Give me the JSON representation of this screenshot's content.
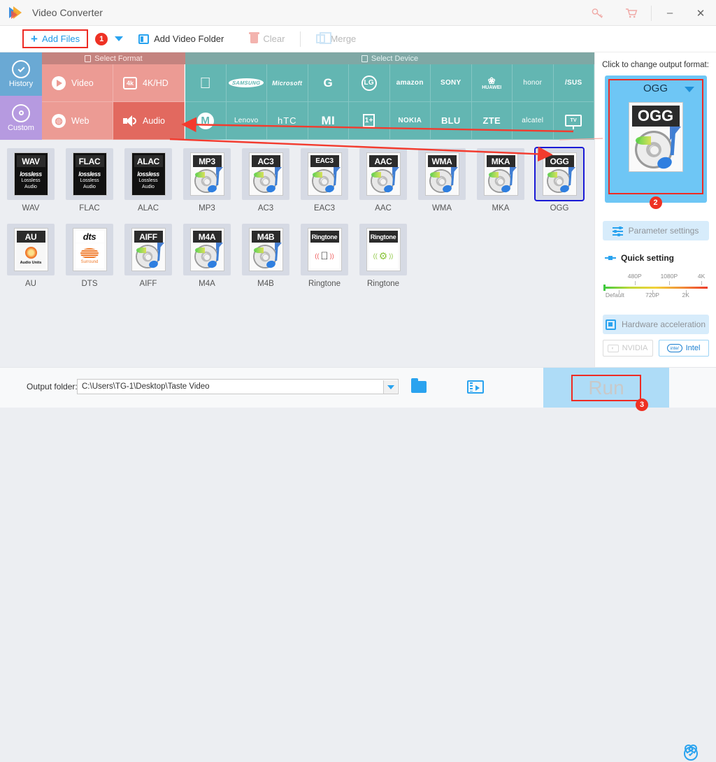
{
  "window": {
    "title": "Video Converter",
    "minimize_label": "–",
    "close_label": "✕",
    "key_icon": "key-icon",
    "cart_icon": "cart-icon"
  },
  "toolbar": {
    "add_files": "Add Files",
    "badge_1": "1",
    "add_video_folder": "Add Video Folder",
    "clear": "Clear",
    "merge": "Merge"
  },
  "sidebar": {
    "items": [
      {
        "label": "History",
        "icon": "history-icon",
        "color": "#6aa9d4"
      },
      {
        "label": "Custom",
        "icon": "gear-icon",
        "color": "#b69ae0"
      }
    ]
  },
  "select_format": {
    "header": "Select Format",
    "items": [
      {
        "label": "Video",
        "icon": "play-icon",
        "selected": false
      },
      {
        "label": "4K/HD",
        "icon": "4k-icon",
        "selected": false
      },
      {
        "label": "Web",
        "icon": "chrome-icon",
        "selected": false
      },
      {
        "label": "Audio",
        "icon": "speaker-icon",
        "selected": true
      }
    ]
  },
  "select_device": {
    "header": "Select Device",
    "row1": [
      "Apple",
      "SAMSUNG",
      "Microsoft",
      "G",
      "LG",
      "amazon",
      "SONY",
      "HUAWEI",
      "honor",
      "/SUS"
    ],
    "row2": [
      "Motorola",
      "Lenovo",
      "hTC",
      "MI",
      "1+",
      "NOKIA",
      "BLU",
      "ZTE",
      "alcatel",
      "TV"
    ]
  },
  "formats": {
    "row1": [
      {
        "label": "WAV",
        "cap": "WAV",
        "style": "lossless",
        "selected": false
      },
      {
        "label": "FLAC",
        "cap": "FLAC",
        "style": "lossless",
        "selected": false
      },
      {
        "label": "ALAC",
        "cap": "ALAC",
        "style": "lossless",
        "selected": false
      },
      {
        "label": "MP3",
        "cap": "MP3",
        "style": "disc",
        "selected": false
      },
      {
        "label": "AC3",
        "cap": "AC3",
        "style": "disc",
        "selected": false
      },
      {
        "label": "EAC3",
        "cap": "EAC3",
        "style": "disc",
        "selected": false
      },
      {
        "label": "AAC",
        "cap": "AAC",
        "style": "disc",
        "selected": false
      },
      {
        "label": "WMA",
        "cap": "WMA",
        "style": "disc",
        "selected": false
      },
      {
        "label": "MKA",
        "cap": "MKA",
        "style": "disc",
        "selected": false
      },
      {
        "label": "OGG",
        "cap": "OGG",
        "style": "disc",
        "selected": true
      }
    ],
    "row2": [
      {
        "label": "AU",
        "cap": "AU",
        "style": "au",
        "selected": false
      },
      {
        "label": "DTS",
        "cap": "dts",
        "style": "dts",
        "selected": false
      },
      {
        "label": "AIFF",
        "cap": "AIFF",
        "style": "disc",
        "selected": false
      },
      {
        "label": "M4A",
        "cap": "M4A",
        "style": "disc",
        "selected": false
      },
      {
        "label": "M4B",
        "cap": "M4B",
        "style": "disc",
        "selected": false
      },
      {
        "label": "Ringtone",
        "cap": "Ringtone",
        "style": "ring-apple",
        "selected": false
      },
      {
        "label": "Ringtone",
        "cap": "Ringtone",
        "style": "ring-android",
        "selected": false
      }
    ],
    "lossless_word": "lossless",
    "lossless_line1": "Lossless",
    "lossless_line2": "Audio",
    "au_sub": "Audio Units",
    "dts_sub": "Surround"
  },
  "right_panel": {
    "title": "Click to change output format:",
    "output_format": "OGG",
    "output_cap": "OGG",
    "badge_2": "2",
    "parameter_settings": "Parameter settings",
    "quick_setting": "Quick setting",
    "quality_top": [
      "480P",
      "1080P",
      "4K"
    ],
    "quality_bottom": [
      "Default",
      "720P",
      "2K"
    ],
    "hardware_acceleration": "Hardware acceleration",
    "nvidia": "NVIDIA",
    "intel": "Intel",
    "intel_badge": "intel"
  },
  "bottom": {
    "output_folder_label": "Output folder:",
    "output_folder_path": "C:\\Users\\TG-1\\Desktop\\Taste Video",
    "open_folder_icon": "open-folder-icon",
    "add_media_icon": "media-library-icon",
    "run_label": "Run",
    "badge_3": "3",
    "alarm_icon": "alarm-clock-icon"
  },
  "colors": {
    "accent_blue": "#2aa3ef",
    "annotation_red": "#ee2b24",
    "audio_selected": "#e2695f",
    "format_strip": "#ec9b94",
    "device_strip": "#63b6b2",
    "selection_blue": "#1a1ad6",
    "run_zone": "#aedcf7"
  }
}
